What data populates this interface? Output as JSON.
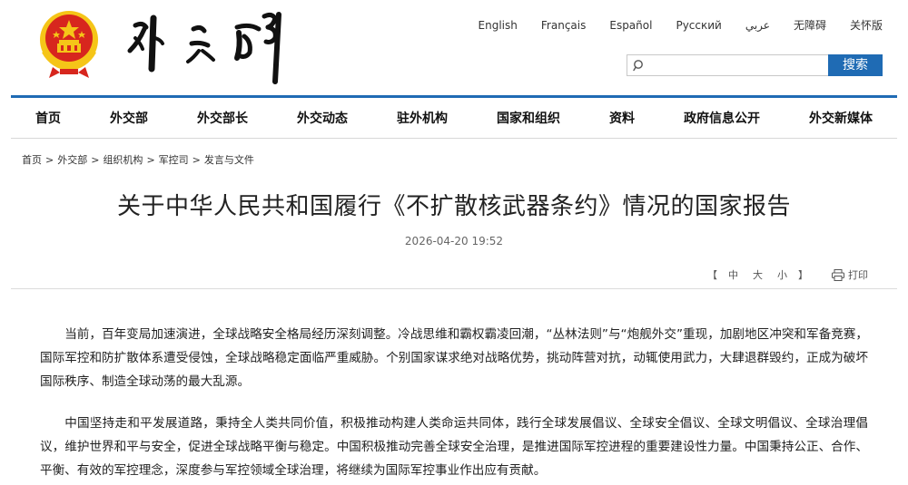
{
  "header": {
    "languages": [
      "English",
      "Français",
      "Español",
      "Русский",
      "عربي",
      "无障碍",
      "关怀版"
    ],
    "search": {
      "placeholder": "",
      "button_label": "搜索"
    }
  },
  "nav": {
    "items": [
      "首页",
      "外交部",
      "外交部长",
      "外交动态",
      "驻外机构",
      "国家和组织",
      "资料",
      "政府信息公开",
      "外交新媒体"
    ]
  },
  "breadcrumb": [
    "首页",
    "外交部",
    "组织机构",
    "军控司",
    "发言与文件"
  ],
  "breadcrumb_separator": ">",
  "article": {
    "title": "关于中华人民共和国履行《不扩散核武器条约》情况的国家报告",
    "date": "2026-04-20 19:52",
    "font_size": {
      "open": "【",
      "large": "中",
      "medium": "大",
      "small": "小",
      "close": "】"
    },
    "print_label": "打印",
    "paragraphs": [
      "当前，百年变局加速演进，全球战略安全格局经历深刻调整。冷战思维和霸权霸凌回潮，“丛林法则”与“炮舰外交”重现，加剧地区冲突和军备竞赛，国际军控和防扩散体系遭受侵蚀，全球战略稳定面临严重威胁。个别国家谋求绝对战略优势，挑动阵营对抗，动辄使用武力，大肆退群毁约，正成为破坏国际秩序、制造全球动荡的最大乱源。",
      "中国坚持走和平发展道路，秉持全人类共同价值，积极推动构建人类命运共同体，践行全球发展倡议、全球安全倡议、全球文明倡议、全球治理倡议，维护世界和平与安全，促进全球战略平衡与稳定。中国积极推动完善全球安全治理，是推进国际军控进程的重要建设性力量。中国秉持公正、合作、平衡、有效的军控理念，深度参与军控领域全球治理，将继续为国际军控事业作出应有贡献。"
    ]
  },
  "colors": {
    "accent": "#1f6bb4",
    "emblem_red": "#d7261e",
    "emblem_gold": "#f5c518"
  },
  "icons": {
    "emblem": "national-emblem",
    "calligraphy": "ministry-calligraphy-logo",
    "search": "search-icon",
    "print": "print-icon"
  }
}
